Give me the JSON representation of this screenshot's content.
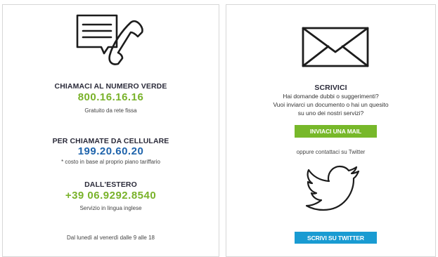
{
  "phone_panel": {
    "toll_free": {
      "heading": "CHIAMACI AL NUMERO VERDE",
      "number": "800.16.16.16",
      "note": "Gratuito da rete fissa"
    },
    "mobile": {
      "heading": "PER CHIAMATE DA CELLULARE",
      "number": "199.20.60.20",
      "note": "* costo in base al proprio piano tariffario"
    },
    "abroad": {
      "heading": "DALL'ESTERO",
      "number": "+39 06.9292.8540",
      "note": "Servizio in lingua inglese"
    },
    "hours": "Dal lunedì al venerdì dalle 9 alle 18"
  },
  "write_panel": {
    "heading": "SCRIVICI",
    "text_lines": [
      "Hai domande dubbi o suggerimenti?",
      "Vuoi inviarci un documento o hai un quesito",
      "su uno dei nostri servizi?"
    ],
    "mail_button": "INVIACI UNA MAIL",
    "twitter_note": "oppure contattaci su Twitter",
    "twitter_button": "SCRIVI SU TWITTER"
  },
  "colors": {
    "green": "#79b22a",
    "blue": "#1e63ab",
    "twitter_blue": "#199bd2",
    "heading": "#2b2b3a"
  },
  "icons": [
    "chat-phone-icon",
    "envelope-icon",
    "twitter-bird-icon"
  ]
}
